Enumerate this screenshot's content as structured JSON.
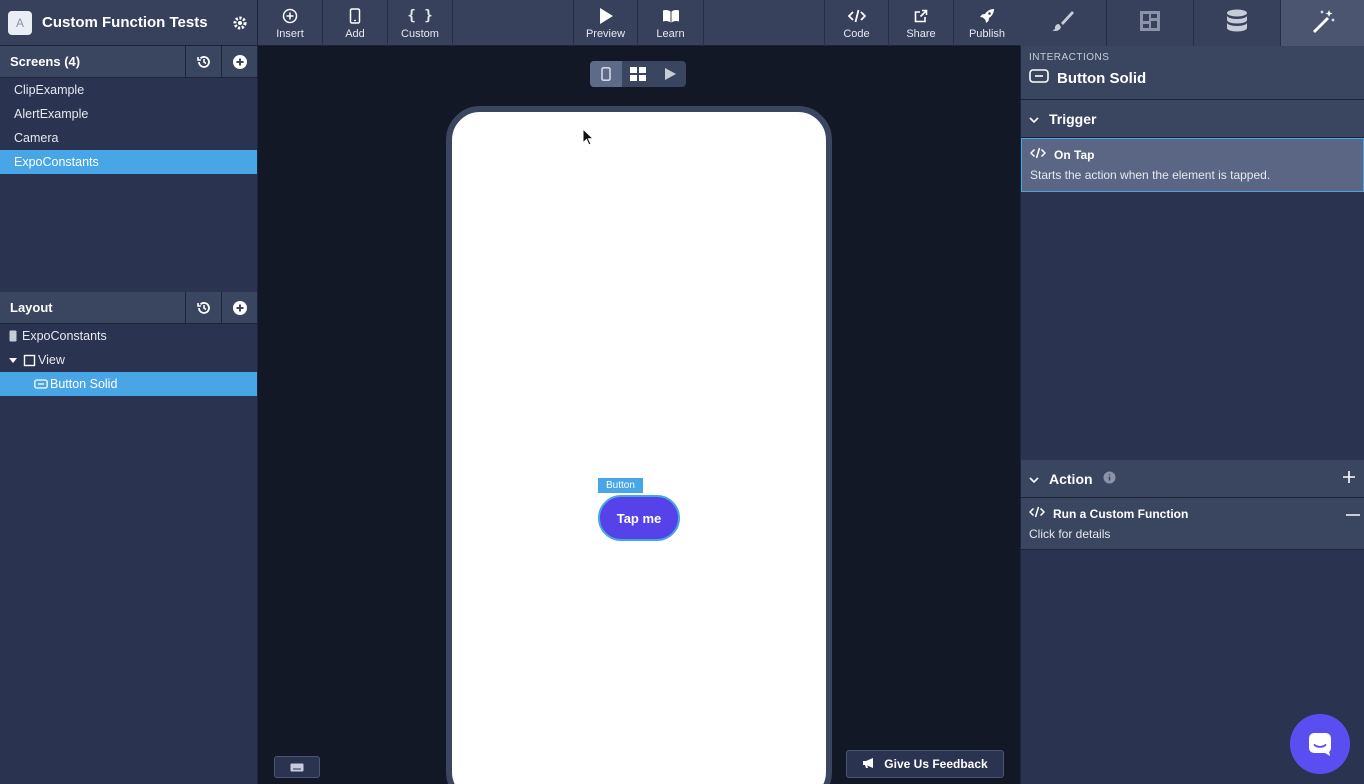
{
  "project": {
    "title": "Custom Function Tests",
    "logo_letter": "A"
  },
  "screens": {
    "header": "Screens (4)",
    "items": [
      {
        "label": "ClipExample",
        "selected": false
      },
      {
        "label": "AlertExample",
        "selected": false
      },
      {
        "label": "Camera",
        "selected": false
      },
      {
        "label": "ExpoConstants",
        "selected": true
      }
    ]
  },
  "layout": {
    "header": "Layout",
    "items": [
      {
        "label": "ExpoConstants",
        "icon": "phone-icon"
      },
      {
        "label": "View",
        "icon": "frame-icon"
      },
      {
        "label": "Button Solid",
        "icon": "button-icon",
        "selected": true
      }
    ]
  },
  "toolbar": {
    "insert": "Insert",
    "add": "Add",
    "custom": "Custom",
    "preview": "Preview",
    "learn": "Learn",
    "code": "Code",
    "share": "Share",
    "publish": "Publish"
  },
  "canvas": {
    "button_tag": "Button",
    "button_text": "Tap me",
    "feedback": "Give Us Feedback"
  },
  "interactions": {
    "label": "INTERACTIONS",
    "title": "Button Solid",
    "trigger_header": "Trigger",
    "trigger_title": "On Tap",
    "trigger_desc": "Starts the action when the element is tapped.",
    "action_header": "Action",
    "action_title": "Run a Custom Function",
    "action_desc": "Click for details"
  },
  "colors": {
    "accent": "#49a6e6",
    "button": "#5542e8",
    "chat": "#5b4ef0"
  }
}
